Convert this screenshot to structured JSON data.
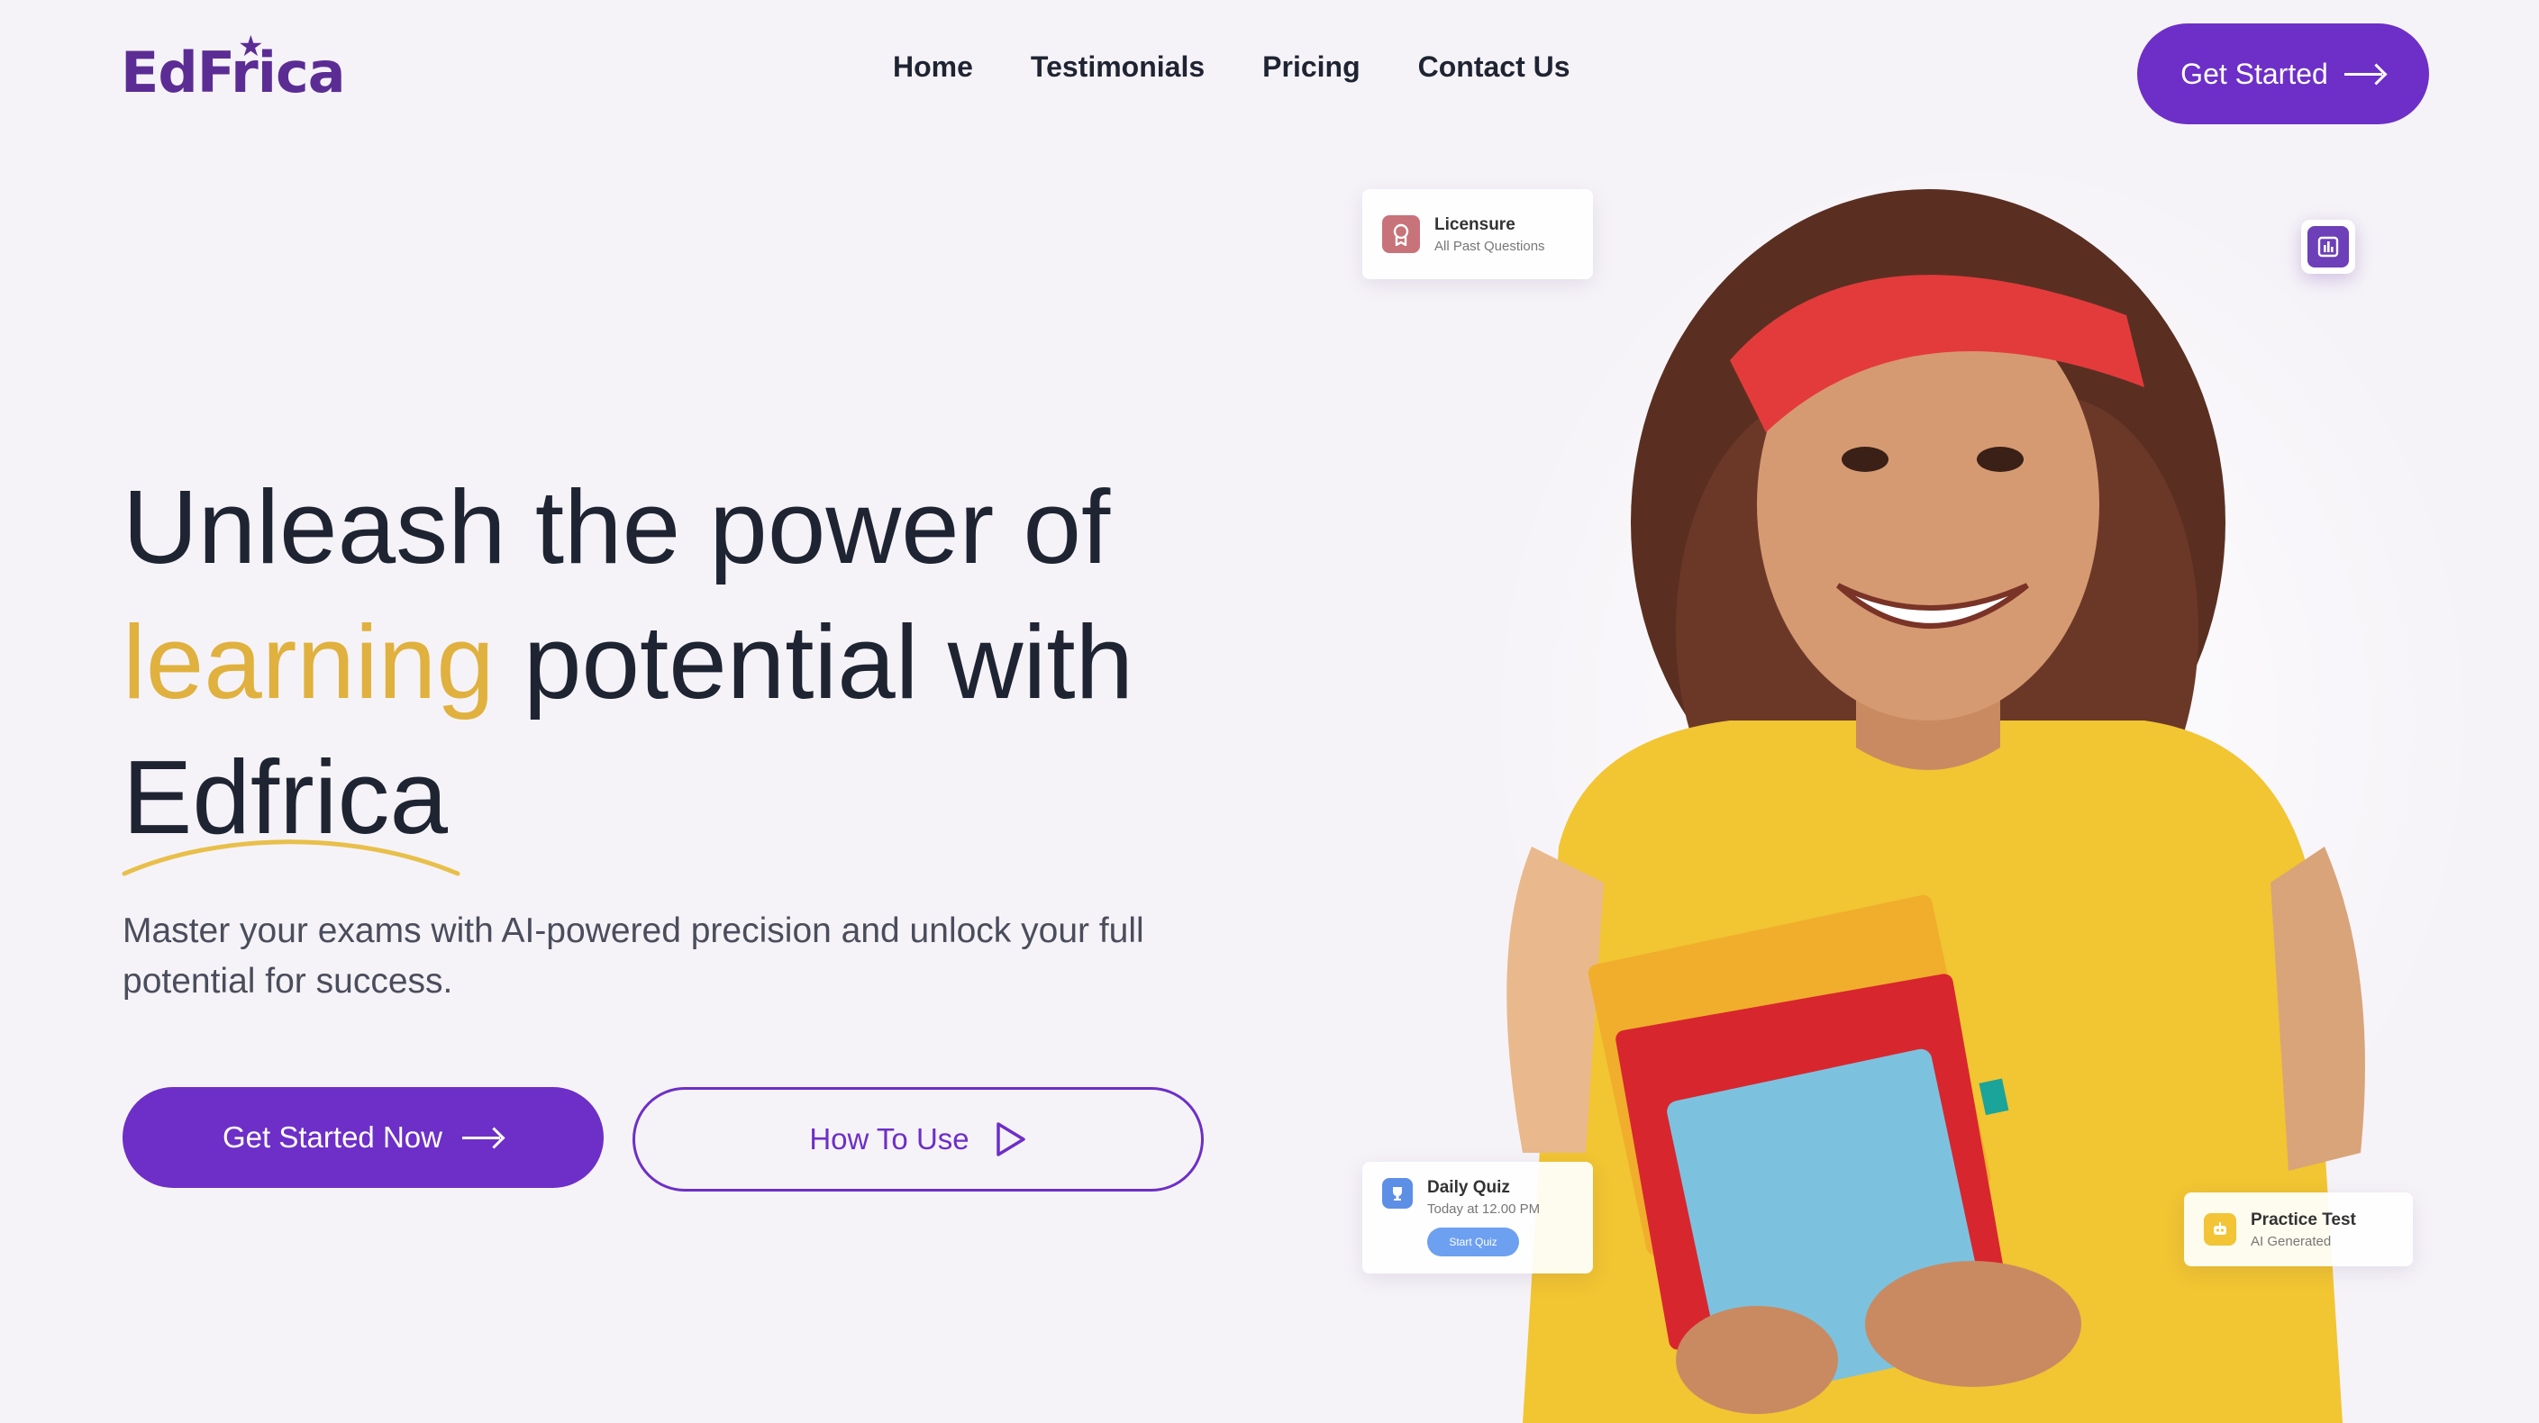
{
  "brand": {
    "logo_text": "EdFrica"
  },
  "nav": {
    "items": [
      "Home",
      "Testimonials",
      "Pricing",
      "Contact Us"
    ]
  },
  "header": {
    "cta_label": "Get Started"
  },
  "hero": {
    "headline_part1": "Unleash the power of",
    "headline_highlight": "learning",
    "headline_part2": " potential with",
    "headline_part3": "Edfrica",
    "subtitle": "Master your exams with AI-powered precision and unlock your full potential for success.",
    "primary_button": "Get Started Now",
    "secondary_button": "How To Use"
  },
  "cards": {
    "licensure": {
      "title": "Licensure",
      "subtitle": "All Past Questions"
    },
    "daily_quiz": {
      "title": "Daily Quiz",
      "subtitle": "Today at 12.00 PM",
      "button": "Start Quiz"
    },
    "practice_test": {
      "title": "Practice Test",
      "subtitle": "AI Generated"
    }
  },
  "colors": {
    "brand_purple": "#6d2fc7",
    "accent_gold": "#e0b13e",
    "background": "#f6f3f8",
    "text_dark": "#1f2433"
  },
  "icons": {
    "licensure": "certificate-icon",
    "daily_quiz": "trophy-icon",
    "practice_test": "robot-icon",
    "stats_badge": "bar-chart-icon"
  }
}
